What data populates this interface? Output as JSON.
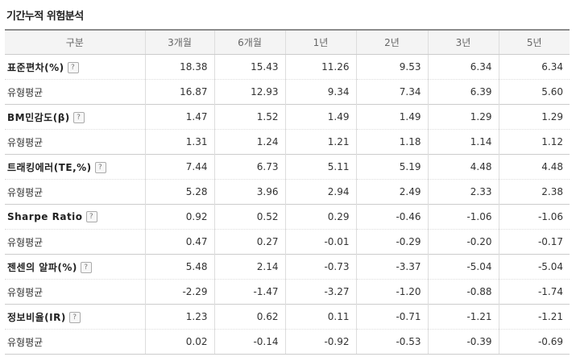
{
  "title": "기간누적 위험분석",
  "header": [
    "구분",
    "3개월",
    "6개월",
    "1년",
    "2년",
    "3년",
    "5년"
  ],
  "help_glyph": "?",
  "rows": [
    {
      "label": "표준편차(%)",
      "values": [
        "18.38",
        "15.43",
        "11.26",
        "9.53",
        "6.34",
        "6.34"
      ],
      "avg_label": "유형평균",
      "avg_values": [
        "16.87",
        "12.93",
        "9.34",
        "7.34",
        "6.39",
        "5.60"
      ]
    },
    {
      "label": "BM민감도(β)",
      "values": [
        "1.47",
        "1.52",
        "1.49",
        "1.49",
        "1.29",
        "1.29"
      ],
      "avg_label": "유형평균",
      "avg_values": [
        "1.31",
        "1.24",
        "1.21",
        "1.18",
        "1.14",
        "1.12"
      ]
    },
    {
      "label": "트래킹에러(TE,%)",
      "values": [
        "7.44",
        "6.73",
        "5.11",
        "5.19",
        "4.48",
        "4.48"
      ],
      "avg_label": "유형평균",
      "avg_values": [
        "5.28",
        "3.96",
        "2.94",
        "2.49",
        "2.33",
        "2.38"
      ]
    },
    {
      "label": "Sharpe Ratio",
      "values": [
        "0.92",
        "0.52",
        "0.29",
        "-0.46",
        "-1.06",
        "-1.06"
      ],
      "avg_label": "유형평균",
      "avg_values": [
        "0.47",
        "0.27",
        "-0.01",
        "-0.29",
        "-0.20",
        "-0.17"
      ]
    },
    {
      "label": "젠센의 알파(%)",
      "values": [
        "5.48",
        "2.14",
        "-0.73",
        "-3.37",
        "-5.04",
        "-5.04"
      ],
      "avg_label": "유형평균",
      "avg_values": [
        "-2.29",
        "-1.47",
        "-3.27",
        "-1.20",
        "-0.88",
        "-1.74"
      ]
    },
    {
      "label": "정보비율(IR)",
      "values": [
        "1.23",
        "0.62",
        "0.11",
        "-0.71",
        "-1.21",
        "-1.21"
      ],
      "avg_label": "유형평균",
      "avg_values": [
        "0.02",
        "-0.14",
        "-0.92",
        "-0.53",
        "-0.39",
        "-0.69"
      ]
    }
  ]
}
